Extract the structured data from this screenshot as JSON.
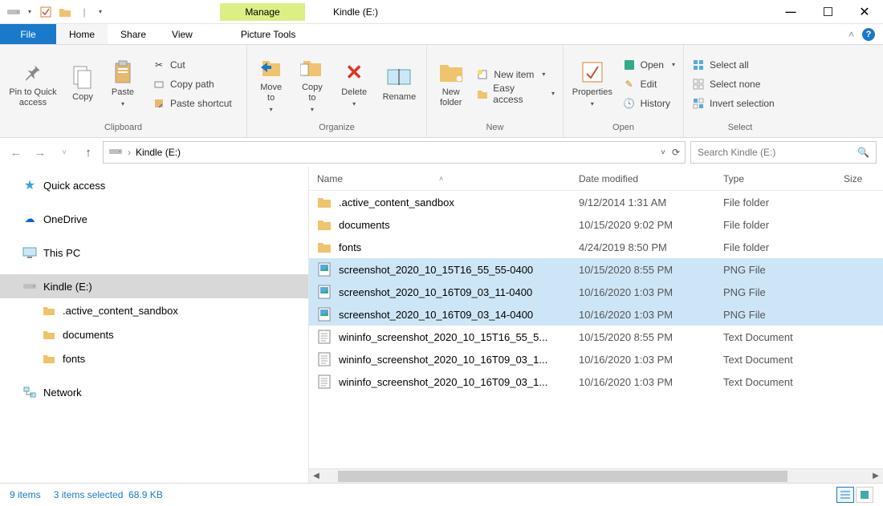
{
  "title": "Kindle (E:)",
  "context_tab_header": "Manage",
  "context_tab": "Picture Tools",
  "tabs": {
    "file": "File",
    "home": "Home",
    "share": "Share",
    "view": "View"
  },
  "ribbon": {
    "clipboard": {
      "label": "Clipboard",
      "pin": "Pin to Quick\naccess",
      "copy": "Copy",
      "paste": "Paste",
      "cut": "Cut",
      "copy_path": "Copy path",
      "paste_shortcut": "Paste shortcut"
    },
    "organize": {
      "label": "Organize",
      "move_to": "Move\nto",
      "copy_to": "Copy\nto",
      "delete": "Delete",
      "rename": "Rename"
    },
    "new": {
      "label": "New",
      "new_folder": "New\nfolder",
      "new_item": "New item",
      "easy_access": "Easy access"
    },
    "open": {
      "label": "Open",
      "properties": "Properties",
      "open": "Open",
      "edit": "Edit",
      "history": "History"
    },
    "select": {
      "label": "Select",
      "select_all": "Select all",
      "select_none": "Select none",
      "invert": "Invert selection"
    }
  },
  "address": {
    "path": "Kindle (E:)"
  },
  "search_placeholder": "Search Kindle (E:)",
  "columns": {
    "name": "Name",
    "date": "Date modified",
    "type": "Type",
    "size": "Size"
  },
  "nav": {
    "quick": "Quick access",
    "onedrive": "OneDrive",
    "thispc": "This PC",
    "kindle": "Kindle (E:)",
    "sub1": ".active_content_sandbox",
    "sub2": "documents",
    "sub3": "fonts",
    "network": "Network"
  },
  "files": [
    {
      "name": ".active_content_sandbox",
      "date": "9/12/2014 1:31 AM",
      "type": "File folder",
      "icon": "folder",
      "sel": false
    },
    {
      "name": "documents",
      "date": "10/15/2020 9:02 PM",
      "type": "File folder",
      "icon": "folder",
      "sel": false
    },
    {
      "name": "fonts",
      "date": "4/24/2019 8:50 PM",
      "type": "File folder",
      "icon": "folder",
      "sel": false
    },
    {
      "name": "screenshot_2020_10_15T16_55_55-0400",
      "date": "10/15/2020 8:55 PM",
      "type": "PNG File",
      "icon": "image",
      "sel": true
    },
    {
      "name": "screenshot_2020_10_16T09_03_11-0400",
      "date": "10/16/2020 1:03 PM",
      "type": "PNG File",
      "icon": "image",
      "sel": true
    },
    {
      "name": "screenshot_2020_10_16T09_03_14-0400",
      "date": "10/16/2020 1:03 PM",
      "type": "PNG File",
      "icon": "image",
      "sel": true
    },
    {
      "name": "wininfo_screenshot_2020_10_15T16_55_5...",
      "date": "10/15/2020 8:55 PM",
      "type": "Text Document",
      "icon": "text",
      "sel": false
    },
    {
      "name": "wininfo_screenshot_2020_10_16T09_03_1...",
      "date": "10/16/2020 1:03 PM",
      "type": "Text Document",
      "icon": "text",
      "sel": false
    },
    {
      "name": "wininfo_screenshot_2020_10_16T09_03_1...",
      "date": "10/16/2020 1:03 PM",
      "type": "Text Document",
      "icon": "text",
      "sel": false
    }
  ],
  "status": {
    "items": "9 items",
    "selected": "3 items selected",
    "size": "68.9 KB"
  }
}
